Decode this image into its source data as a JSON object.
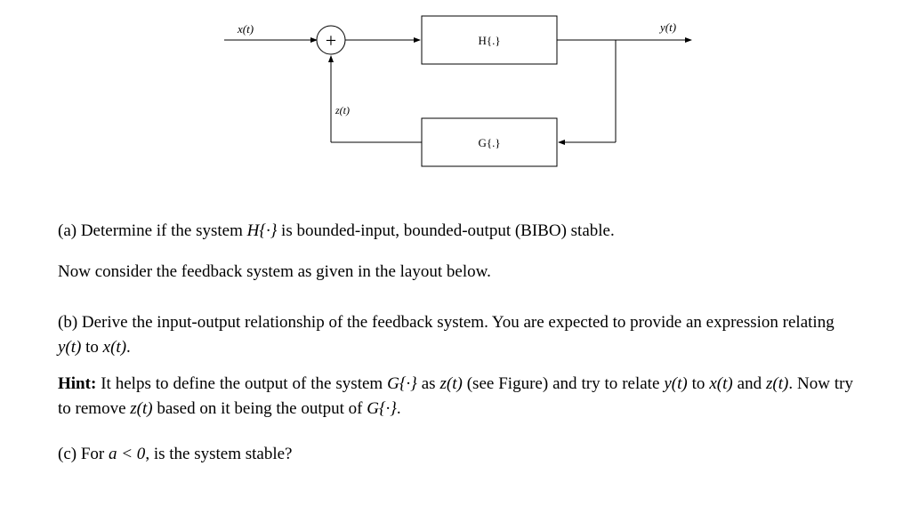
{
  "diagram": {
    "input_label": "x(t)",
    "output_label": "y(t)",
    "feedback_label": "z(t)",
    "summing_symbol": "+",
    "block_H": "H{.}",
    "block_G": "G{.}"
  },
  "text": {
    "part_a_prefix": "(a) Determine if the system ",
    "part_a_sys": "H{·}",
    "part_a_suffix": " is bounded-input, bounded-output (BIBO) stable.",
    "para2": "Now consider the feedback system as given in the layout below.",
    "part_b_line1_prefix": "(b) Derive the input-output relationship of the feedback system. You are expected to provide an expression relating ",
    "yt": "y(t)",
    "to1": " to ",
    "xt": "x(t)",
    "period": ".",
    "hint_label": "Hint:",
    "hint1": " It helps to define the output of the system ",
    "Gsys": "G{·}",
    "hint2": " as ",
    "zt": "z(t)",
    "hint3": " (see Figure) and try to relate ",
    "hint4": " to ",
    "hint5": " and ",
    "hint6": ". Now try to remove ",
    "hint7": " based on it being the output of ",
    "part_c_prefix": "(c) For ",
    "aless": "a < 0",
    "part_c_suffix": ", is the system stable?"
  }
}
